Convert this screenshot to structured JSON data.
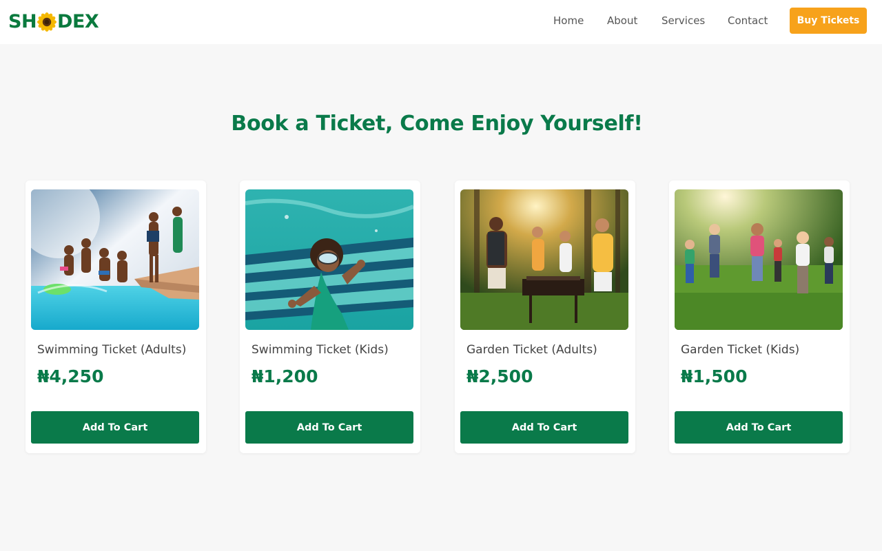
{
  "brand": {
    "logo_left": "SH",
    "logo_right": "DEX",
    "logo_color": "#0a7a3e",
    "logo_icon": "sunflower-icon"
  },
  "nav": {
    "items": [
      {
        "label": "Home"
      },
      {
        "label": "About"
      },
      {
        "label": "Services"
      },
      {
        "label": "Contact"
      }
    ],
    "cta_label": "Buy Tickets",
    "cta_color": "#f7a21b"
  },
  "main": {
    "headline": "Book a Ticket, Come Enjoy Yourself!",
    "accent_color": "#0a7a4a",
    "tickets": [
      {
        "title": "Swimming Ticket (Adults)",
        "price": "₦4,250",
        "button_label": "Add To Cart",
        "image": "adults-pool-party-photo"
      },
      {
        "title": "Swimming Ticket (Kids)",
        "price": "₦1,200",
        "button_label": "Add To Cart",
        "image": "kid-underwater-pool-photo"
      },
      {
        "title": "Garden Ticket (Adults)",
        "price": "₦2,500",
        "button_label": "Add To Cart",
        "image": "adults-garden-barbecue-photo"
      },
      {
        "title": "Garden Ticket (Kids)",
        "price": "₦1,500",
        "button_label": "Add To Cart",
        "image": "kids-running-garden-photo"
      }
    ]
  }
}
